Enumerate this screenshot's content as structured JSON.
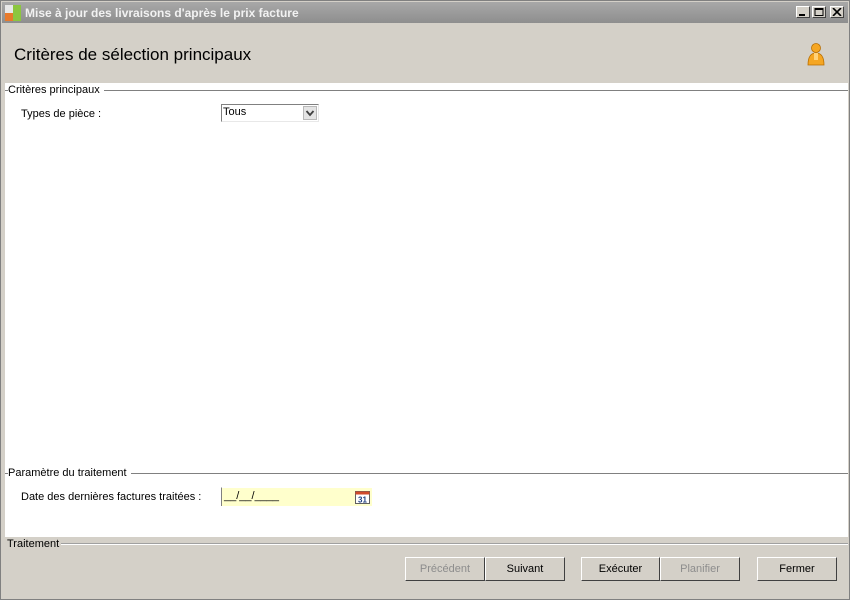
{
  "window": {
    "title": "Mise à jour des livraisons d'après le prix facture"
  },
  "header": {
    "page_title": "Critères de sélection principaux"
  },
  "main_criteria": {
    "group_title": "Critères principaux",
    "piece_types_label": "Types de pièce :",
    "piece_types_value": "Tous"
  },
  "treatment_params": {
    "group_title": "Paramètre du traitement",
    "last_invoice_date_label": "Date des dernières factures traitées :",
    "last_invoice_date_value": "__/__/____",
    "calendar_day": "31"
  },
  "footer": {
    "group_title": "Traitement",
    "buttons": {
      "previous": "Précédent",
      "next": "Suivant",
      "execute": "Exécuter",
      "schedule": "Planifier",
      "close": "Fermer"
    }
  },
  "colors": {
    "titlebar": "#9a9a9a",
    "chrome": "#d4d0c8",
    "date_field_bg": "#ffffcc",
    "user_icon": "#f5a623"
  }
}
